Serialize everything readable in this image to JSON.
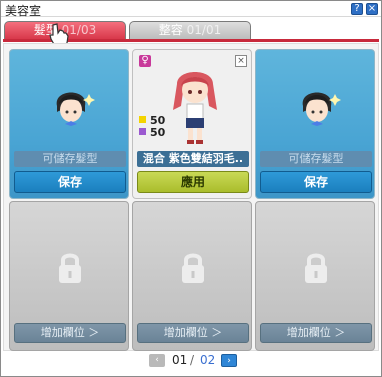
{
  "window": {
    "title": "美容室"
  },
  "tabs": [
    {
      "label": "髮型",
      "count": "01/03",
      "active": true
    },
    {
      "label": "整容",
      "count": "01/01",
      "active": false
    }
  ],
  "slots": [
    {
      "type": "saved",
      "label": "可儲存髮型",
      "button": "保存"
    },
    {
      "type": "current",
      "gender": "♀",
      "stat1": "50",
      "stat2": "50",
      "label": "混合 紫色雙結羽毛..",
      "button": "應用"
    },
    {
      "type": "saved",
      "label": "可儲存髮型",
      "button": "保存"
    },
    {
      "type": "locked",
      "button": "增加欄位 ＞"
    },
    {
      "type": "locked",
      "button": "增加欄位 ＞"
    },
    {
      "type": "locked",
      "button": "增加欄位 ＞"
    }
  ],
  "pager": {
    "current": "01",
    "separator": "/",
    "total": "02"
  },
  "colors": {
    "accent": "#c82a3c",
    "stat1": "#f4d400",
    "stat2": "#9b59d0"
  },
  "icons": [
    "question-icon",
    "close-icon",
    "hand-cursor-icon",
    "lock-icon",
    "prev-page-icon",
    "next-page-icon",
    "female-icon"
  ]
}
